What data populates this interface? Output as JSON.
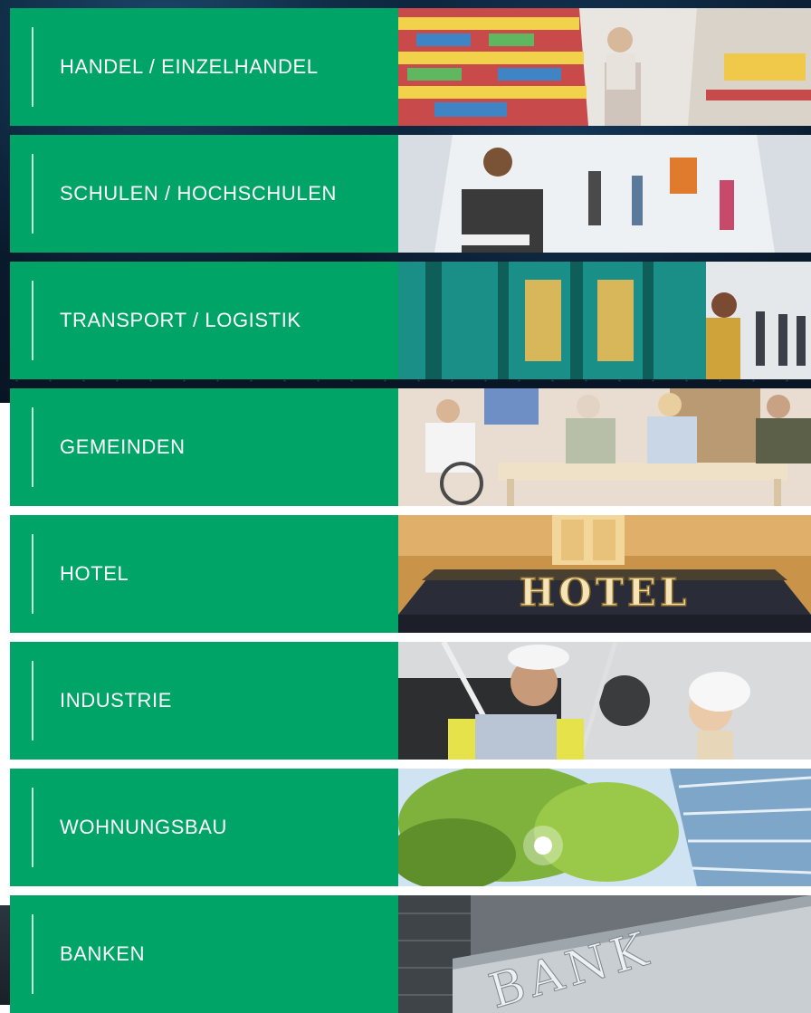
{
  "tiles": [
    {
      "label": "HANDEL / EINZELHANDEL",
      "image": "supermarket-aisle-photo"
    },
    {
      "label": "SCHULEN / HOCHSCHULEN",
      "image": "university-hallway-photo"
    },
    {
      "label": "TRANSPORT / LOGISTIK",
      "image": "train-platform-photo"
    },
    {
      "label": "GEMEINDEN",
      "image": "community-center-photo"
    },
    {
      "label": "HOTEL",
      "image": "hotel-facade-photo",
      "sign": "HOTEL"
    },
    {
      "label": "INDUSTRIE",
      "image": "industrial-workers-photo"
    },
    {
      "label": "WOHNUNGSBAU",
      "image": "residential-building-trees-photo"
    },
    {
      "label": "BANKEN",
      "image": "bank-building-photo",
      "sign": "BANK"
    }
  ]
}
